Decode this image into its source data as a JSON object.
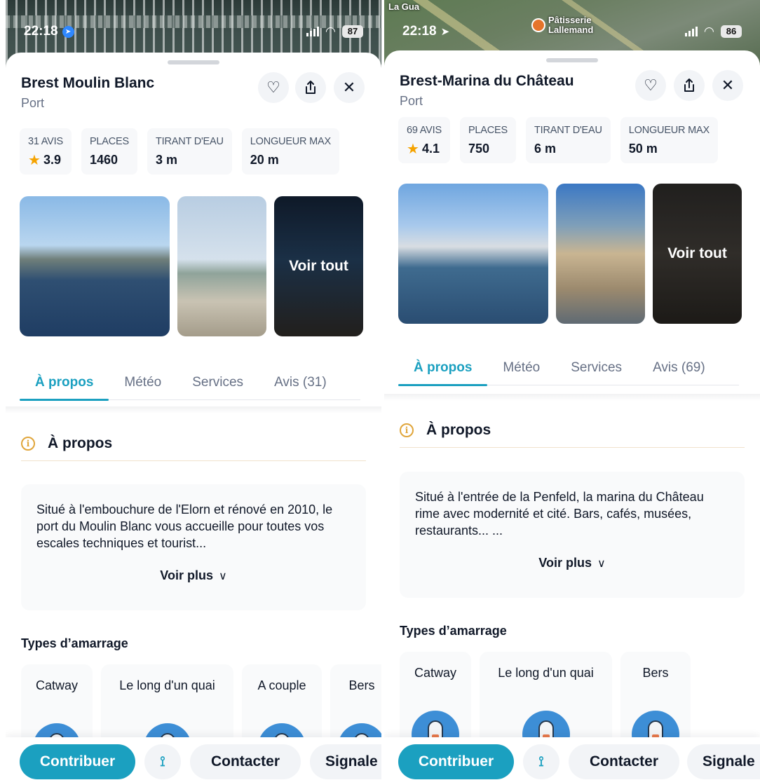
{
  "colors": {
    "accent": "#1ba0c0",
    "star": "#f5a300",
    "info": "#e0a53a",
    "text": "#101828",
    "muted": "#667085"
  },
  "panels": [
    {
      "status": {
        "time": "22:18",
        "battery": "87"
      },
      "map": {
        "label": "",
        "poi": ""
      },
      "title": "Brest Moulin Blanc",
      "subtitle": "Port",
      "actions": {
        "favorite_icon": "heart-icon",
        "share_icon": "share-icon",
        "close_icon": "close-icon"
      },
      "stats": [
        {
          "label": "31 AVIS",
          "value": "3.9"
        },
        {
          "label": "PLACES",
          "value": "1460"
        },
        {
          "label": "TIRANT D'EAU",
          "value": "3 m"
        },
        {
          "label": "LONGUEUR MAX",
          "value": "20 m"
        }
      ],
      "photos": {
        "see_all": "Voir tout"
      },
      "tabs": [
        "À propos",
        "Météo",
        "Services",
        "Avis (31)"
      ],
      "about": {
        "title": "À propos",
        "text": "Situé à l'embouchure de l'Elorn et rénové en 2010, le port du Moulin Blanc vous accueille pour toutes vos escales techniques et tourist...",
        "more": "Voir plus"
      },
      "mooring": {
        "title": "Types d’amarrage",
        "types": [
          "Catway",
          "Le long d'un quai",
          "A couple",
          "Bers"
        ]
      },
      "bottom": {
        "contribute": "Contribuer",
        "contact": "Contacter",
        "report": "Signale"
      }
    },
    {
      "status": {
        "time": "22:18",
        "battery": "86"
      },
      "map": {
        "label": "La Gua",
        "poi": "Pâtisserie Lallemand"
      },
      "title": "Brest-Marina du Château",
      "subtitle": "Port",
      "actions": {
        "favorite_icon": "heart-icon",
        "share_icon": "share-icon",
        "close_icon": "close-icon"
      },
      "stats": [
        {
          "label": "69 AVIS",
          "value": "4.1"
        },
        {
          "label": "PLACES",
          "value": "750"
        },
        {
          "label": "TIRANT D'EAU",
          "value": "6 m"
        },
        {
          "label": "LONGUEUR MAX",
          "value": "50 m"
        }
      ],
      "photos": {
        "see_all": "Voir tout"
      },
      "tabs": [
        "À propos",
        "Météo",
        "Services",
        "Avis (69)"
      ],
      "about": {
        "title": "À propos",
        "text": "Situé à l'entrée de la Penfeld, la marina du Château rime avec modernité et cité. Bars, cafés, musées, restaurants... ...",
        "more": "Voir plus"
      },
      "mooring": {
        "title": "Types d’amarrage",
        "types": [
          "Catway",
          "Le long d'un quai",
          "Bers"
        ]
      },
      "bottom": {
        "contribute": "Contribuer",
        "contact": "Contacter",
        "report": "Signale"
      }
    }
  ]
}
